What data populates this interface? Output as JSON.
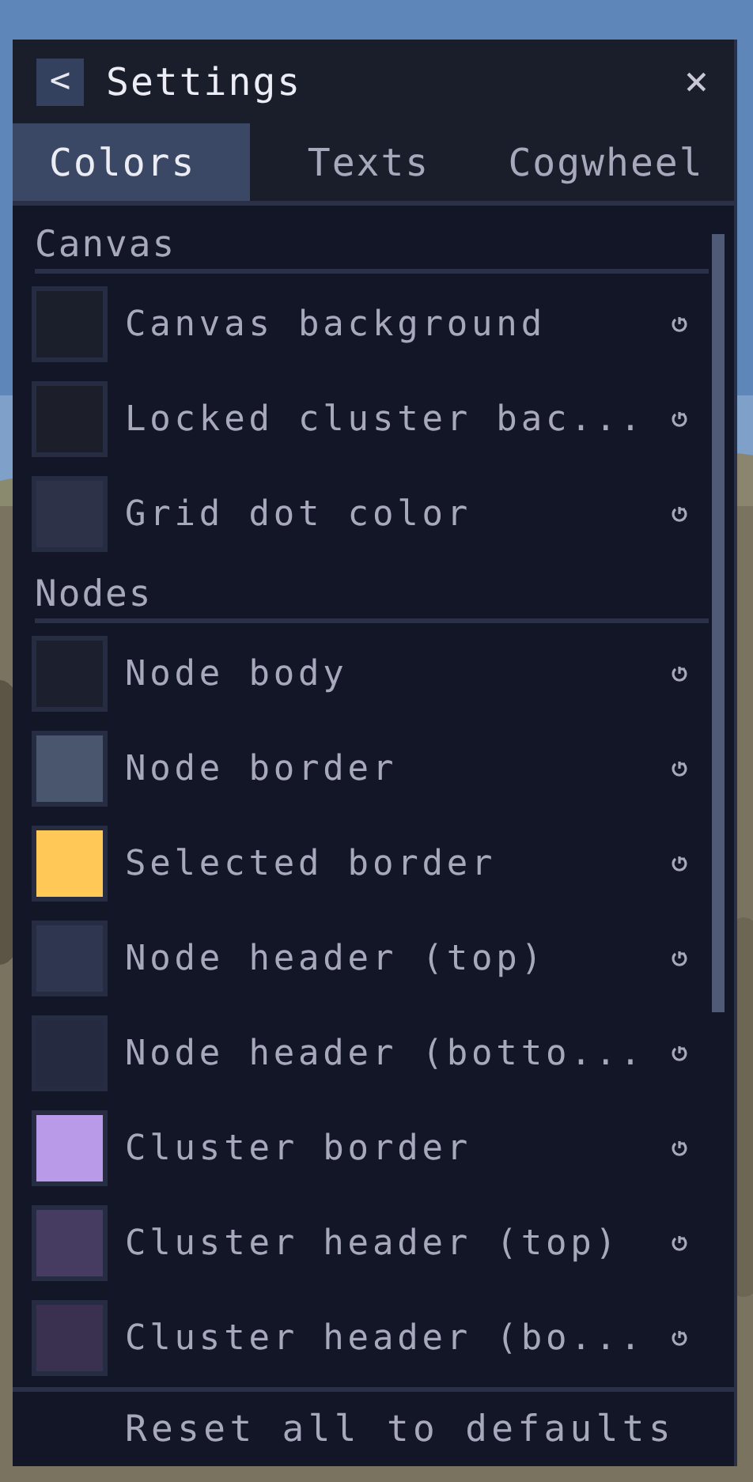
{
  "window": {
    "title": "Settings",
    "back_button": "<",
    "close_button": "×"
  },
  "tabs": [
    {
      "label": "Colors",
      "selected": true
    },
    {
      "label": "Texts",
      "selected": false
    },
    {
      "label": "Cogwheel",
      "selected": false
    }
  ],
  "sections": [
    {
      "heading": "Canvas",
      "items": [
        {
          "label": "Canvas background",
          "color": "#1b1f2c"
        },
        {
          "label": "Locked cluster bac...",
          "color": "#1c1f2a"
        },
        {
          "label": "Grid dot color",
          "color": "#2d3248"
        }
      ]
    },
    {
      "heading": "Nodes",
      "items": [
        {
          "label": "Node body",
          "color": "#1c1f2e"
        },
        {
          "label": "Node border",
          "color": "#4a566e"
        },
        {
          "label": "Selected border",
          "color": "#ffc857"
        },
        {
          "label": "Node header (top)",
          "color": "#2f3650"
        },
        {
          "label": "Node header (botto...",
          "color": "#252a40"
        },
        {
          "label": "Cluster border",
          "color": "#b89ae8"
        },
        {
          "label": "Cluster header (top)",
          "color": "#463c62"
        },
        {
          "label": "Cluster header (bo...",
          "color": "#3a304f"
        }
      ]
    }
  ],
  "footer": {
    "button": "Reset all to defaults"
  }
}
